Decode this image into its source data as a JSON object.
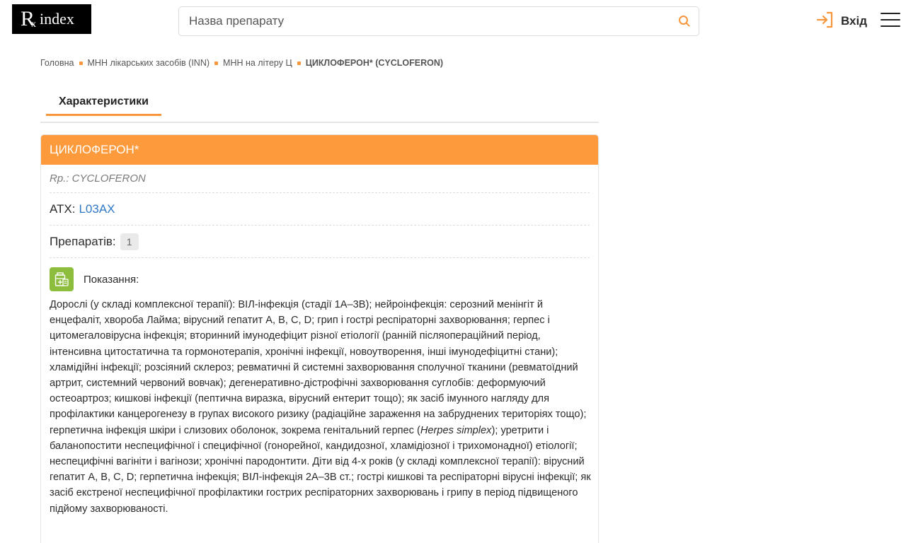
{
  "header": {
    "logo_rx": "R",
    "logo_x": "x",
    "logo_word": "index",
    "search_placeholder": "Назва препарату",
    "login_label": "Вхід",
    "accent_color": "#f7963b"
  },
  "breadcrumb": {
    "items": [
      "Головна",
      "МНН лікарських засобів (INN)",
      "МНН на літеру Ц"
    ],
    "current": "ЦИКЛОФЕРОН* (CYCLOFERON)"
  },
  "tabs": [
    {
      "label": "Характеристики",
      "active": true
    }
  ],
  "drug": {
    "title": "ЦИКЛОФЕРОН*",
    "rp": "Rp.: CYCLOFERON",
    "atx_label": "АТХ:",
    "atx_code": "L03AX",
    "preps_label": "Препаратів:",
    "preps_count": "1",
    "indications_title": "Показання:",
    "indications_part1": "Дорослі (у складі комплексної терапії): ВІЛ-інфекція (стадії 1А–3В); нейроінфекція: серозний менінгіт й енцефаліт, хвороба Лайма; вірусний гепатит А, В, С, D; грип і гострі респіраторні захворювання; герпес і цитомегаловірусна інфекція; вторинний імунодефіцит різної етіології (ранній післяопераційний період, інтенсивна цитостатична та гормонотерапія, хронічні інфекції, новоутворення, інші імунодефіцитні стани); хламідійні інфекції; розсіяний склероз; ревматичні й системні захворювання сполучної тканини (ревматоїдний артрит, системний червоний вовчак); дегенеративно-дістрофічні захворювання суглобів: деформуючий остеоартроз; кишкові інфекції (пептична виразка, вірусний ентерит тощо); як засіб імунного нагляду для профілактики канцерогенезу в групах високого ризику (радіаційне зараження на забруднених територіях тощо); герпетична інфекція шкіри і слизових оболонок, зокрема генітальний герпес (",
    "indications_italic": "Herpes simplex",
    "indications_part2": "); уретрити і баланопостити неспецифічної і специфічної (гонорейної, кандидозної, хламідіозної і трихомонадної) етіології; неспецифічні вагініти і вагінози; хронічні пародонтити. Діти від 4-х років (у складі комплексної терапії): вірусний гепатит А, В, С, D; герпетична інфекція; ВІЛ-інфекція 2А–3В ст.; гострі кишкові та респіраторні вірусні інфекції; як засіб екстреної неспецифічної профілактики гострих респіраторних захворювань і грипу в період підвищеного підйому захворюваності."
  }
}
